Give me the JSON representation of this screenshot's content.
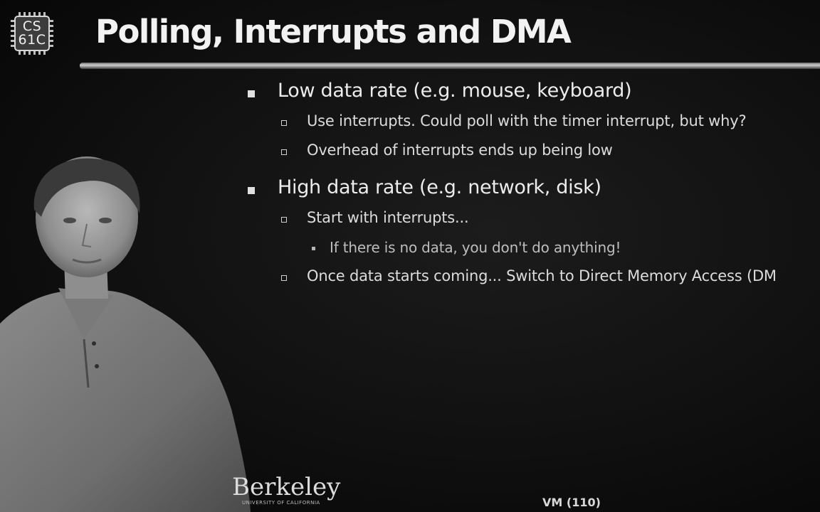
{
  "logo": {
    "line1": "CS",
    "line2": "61C"
  },
  "title": "Polling, Interrupts and DMA",
  "bullets": [
    {
      "level": 1,
      "text": "Low data rate (e.g. mouse, keyboard)"
    },
    {
      "level": 2,
      "text": "Use interrupts. Could poll with the timer interrupt, but why?"
    },
    {
      "level": 2,
      "text": "Overhead of interrupts ends up being low"
    },
    {
      "level": 1,
      "text": "High data rate (e.g. network, disk)"
    },
    {
      "level": 2,
      "text": "Start with interrupts..."
    },
    {
      "level": 3,
      "text": "If there is no data, you don't do anything!"
    },
    {
      "level": 2,
      "text": "Once data starts coming... Switch to Direct Memory Access (DM"
    }
  ],
  "footer": {
    "institution": "Berkeley",
    "institution_sub": "UNIVERSITY OF CALIFORNIA",
    "page_label": "VM (110)"
  },
  "colors": {
    "background": "#101010",
    "text": "#ececec",
    "rule": "#cfcfcf"
  }
}
